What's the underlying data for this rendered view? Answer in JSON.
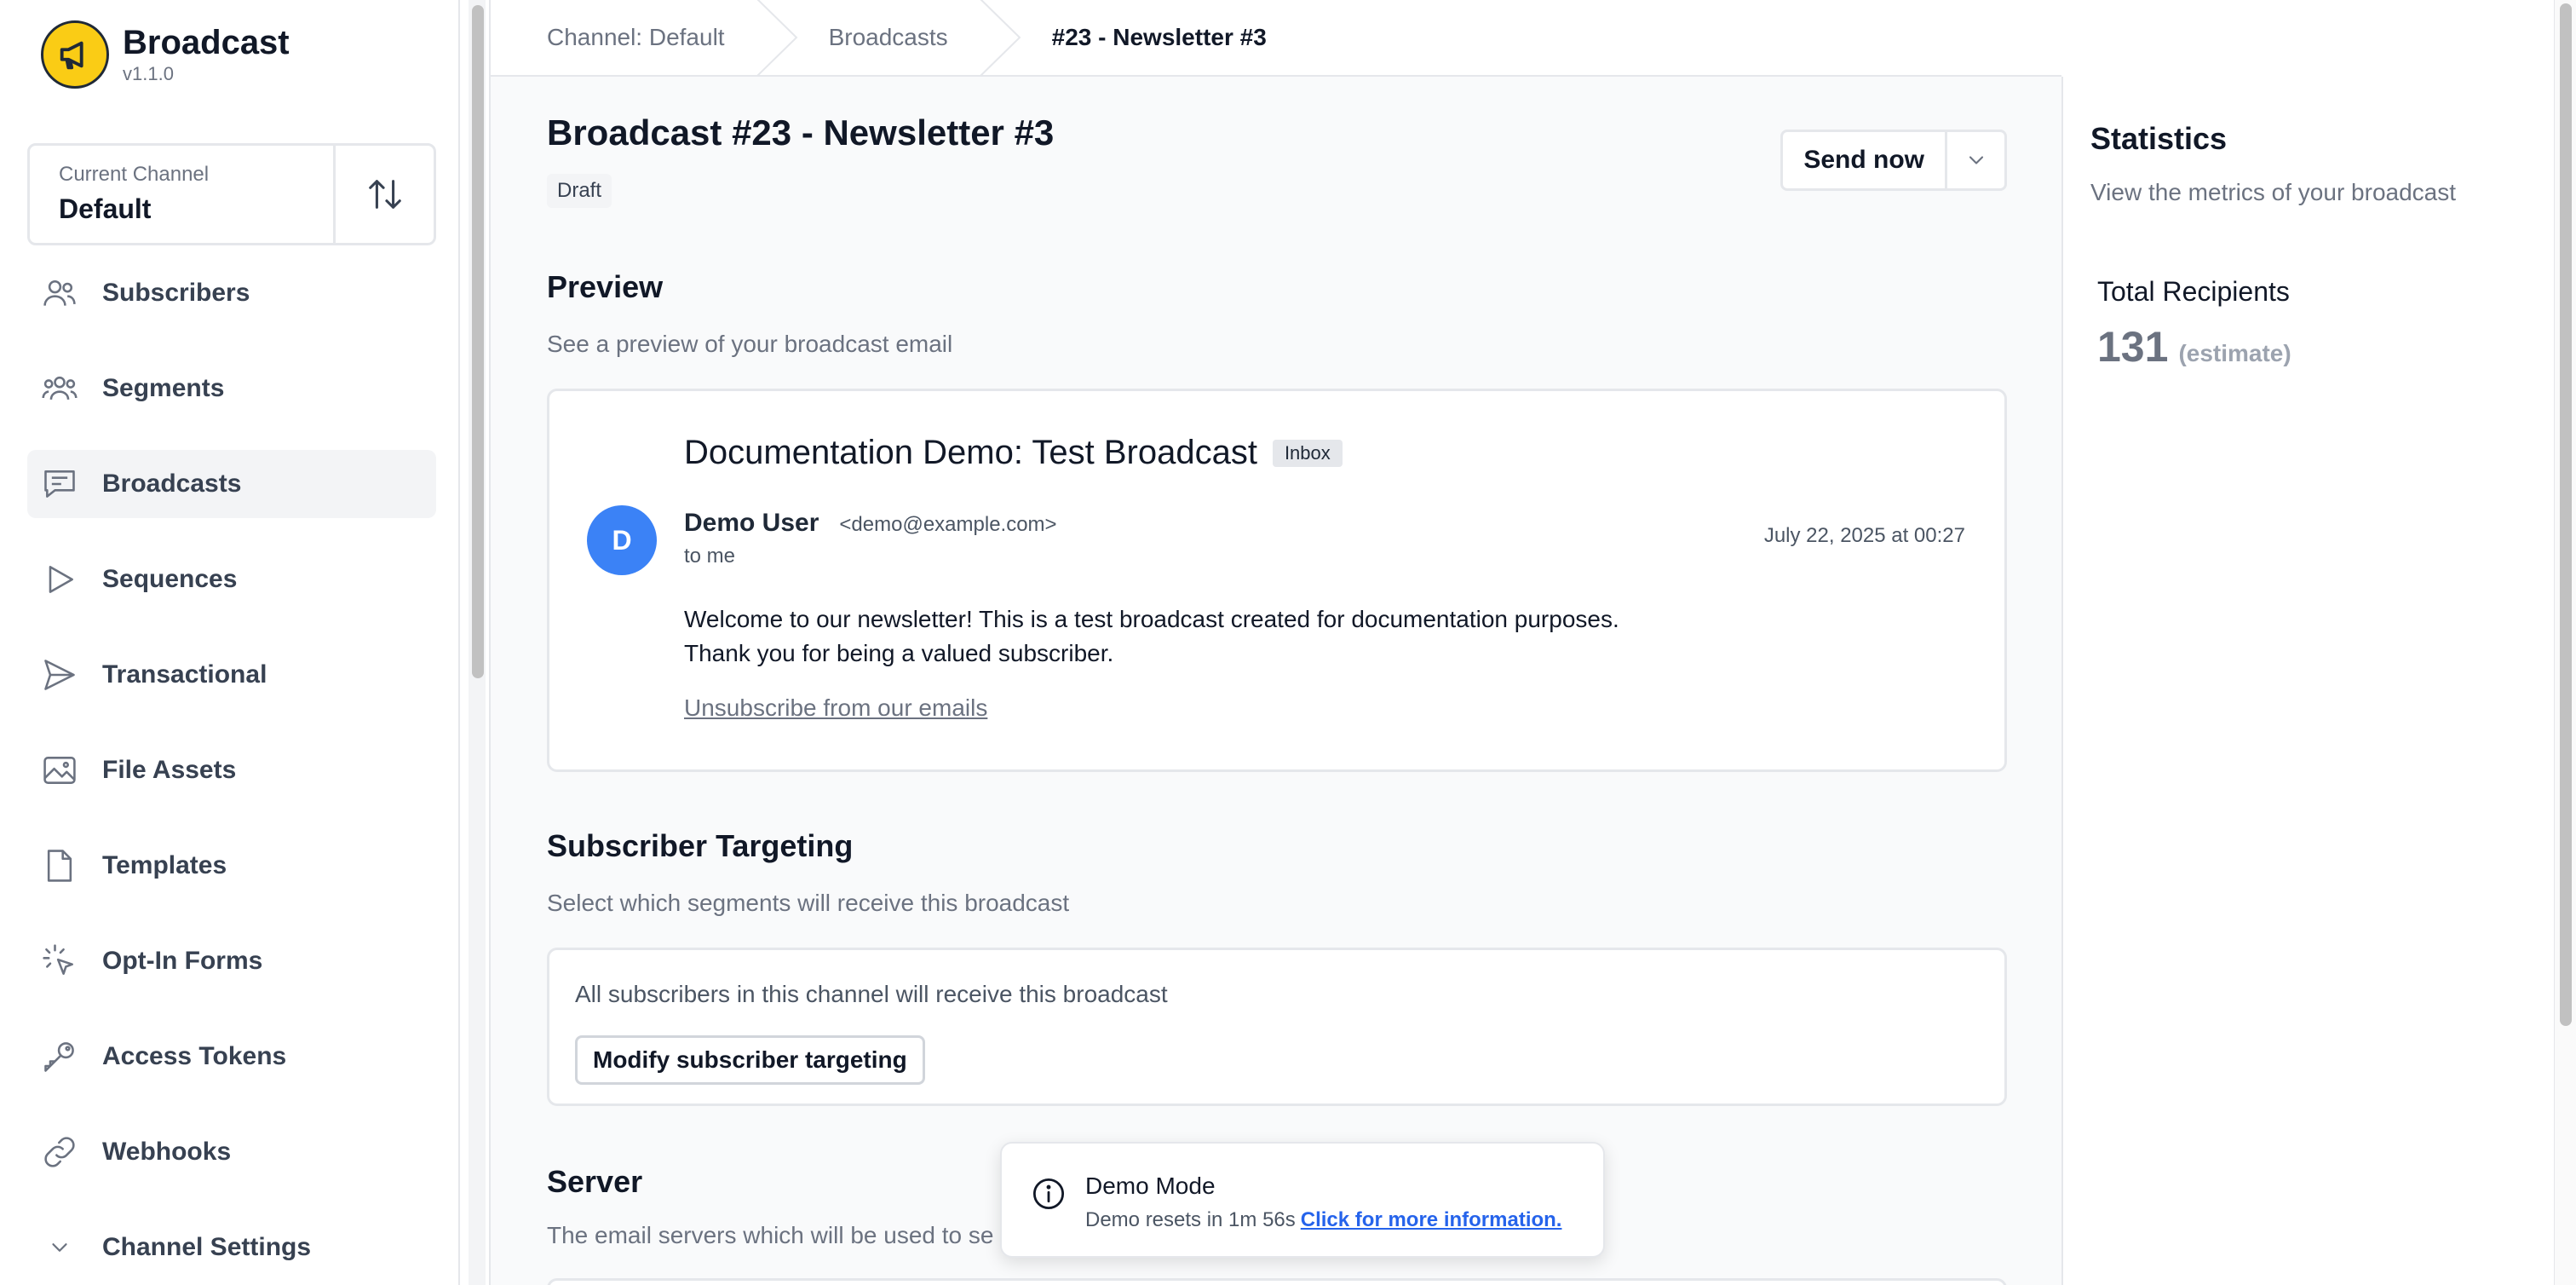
{
  "brand": {
    "name": "Broadcast",
    "version": "v1.1.0"
  },
  "channel": {
    "label": "Current Channel",
    "value": "Default"
  },
  "nav": [
    {
      "label": "Subscribers",
      "icon": "users-icon"
    },
    {
      "label": "Segments",
      "icon": "user-group-icon"
    },
    {
      "label": "Broadcasts",
      "icon": "chat-bubble-icon",
      "active": true
    },
    {
      "label": "Sequences",
      "icon": "play-icon"
    },
    {
      "label": "Transactional",
      "icon": "paper-plane-icon"
    },
    {
      "label": "File Assets",
      "icon": "photo-icon"
    },
    {
      "label": "Templates",
      "icon": "document-icon"
    },
    {
      "label": "Opt-In Forms",
      "icon": "cursor-click-icon"
    },
    {
      "label": "Access Tokens",
      "icon": "key-icon"
    },
    {
      "label": "Webhooks",
      "icon": "link-icon"
    },
    {
      "label": "Channel Settings",
      "icon": "chevron-down-icon"
    }
  ],
  "breadcrumb": [
    "Channel: Default",
    "Broadcasts",
    "#23 - Newsletter #3"
  ],
  "page": {
    "title": "Broadcast #23 - Newsletter #3",
    "status": "Draft",
    "send_label": "Send now"
  },
  "preview": {
    "title": "Preview",
    "description": "See a preview of your broadcast email",
    "subject": "Documentation Demo: Test Broadcast",
    "tag": "Inbox",
    "avatar_letter": "D",
    "sender_name": "Demo User",
    "sender_email": "<demo@example.com>",
    "to": "to me",
    "date": "July 22, 2025 at 00:27",
    "body_line1": "Welcome to our newsletter! This is a test broadcast created for documentation purposes.",
    "body_line2": "Thank you for being a valued subscriber.",
    "unsubscribe": "Unsubscribe from our emails"
  },
  "targeting": {
    "title": "Subscriber Targeting",
    "description": "Select which segments will receive this broadcast",
    "text": "All subscribers in this channel will receive this broadcast",
    "button": "Modify subscriber targeting"
  },
  "server": {
    "title": "Server",
    "description": "The email servers which will be used to se"
  },
  "stats": {
    "title": "Statistics",
    "description": "View the metrics of your broadcast",
    "recipients_label": "Total Recipients",
    "recipients_value": "131",
    "recipients_note": "(estimate)"
  },
  "toast": {
    "title": "Demo Mode",
    "text": "Demo resets in 1m 56s",
    "link": "Click for more information."
  },
  "colors": {
    "brand": "#facc15",
    "avatar": "#3b82f6",
    "link": "#2563eb"
  }
}
